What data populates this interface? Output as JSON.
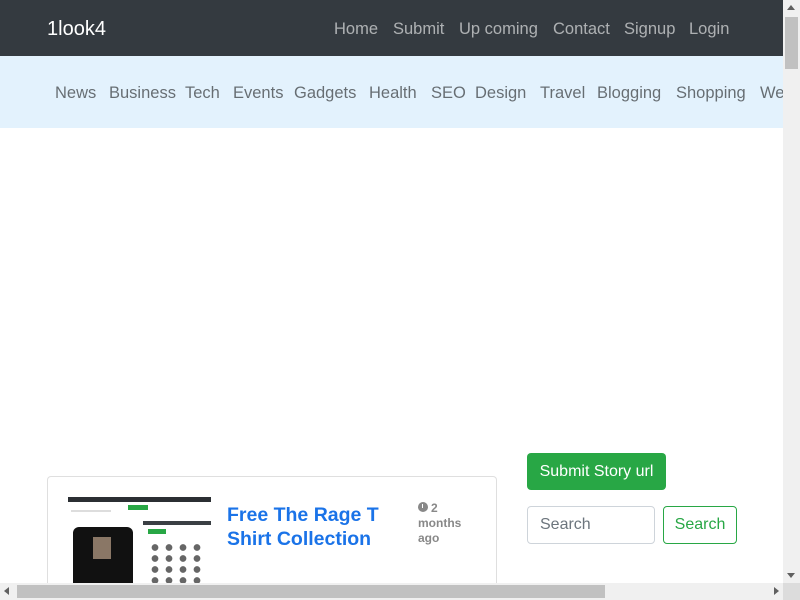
{
  "header": {
    "brand": "1look4",
    "links": [
      "Home",
      "Submit",
      "Up coming",
      "Contact",
      "Signup",
      "Login"
    ]
  },
  "categories": [
    "News",
    "Business",
    "Tech",
    "Events",
    "Gadgets",
    "Health",
    "SEO",
    "Design",
    "Travel",
    "Blogging",
    "Shopping",
    "We"
  ],
  "story": {
    "title": "Free The Rage T Shirt Collection",
    "time": "2 months ago",
    "thumbnail_icon": "product-screenshot-thumbnail"
  },
  "sidebar": {
    "submit_label": "Submit Story url",
    "search_placeholder": "Search",
    "search_button": "Search"
  },
  "colors": {
    "navbar_dark": "#343a40",
    "category_bar": "#e3f2fd",
    "accent_green": "#28a745",
    "title_blue": "#1a73e8"
  }
}
